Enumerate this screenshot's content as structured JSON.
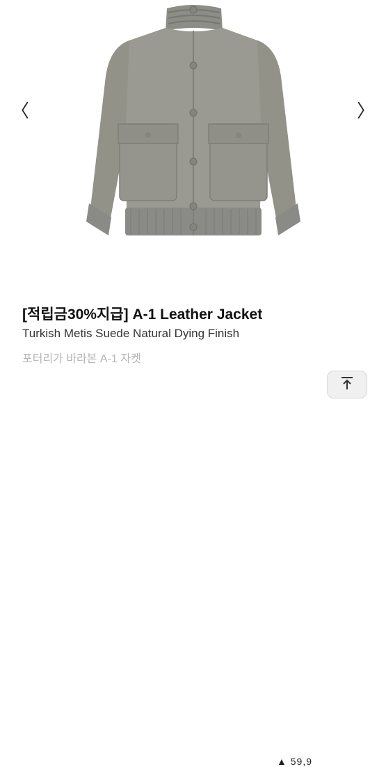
{
  "carousel": {
    "prev_icon": "chevron-left-icon",
    "next_icon": "chevron-right-icon",
    "prev_glyph": "〈",
    "next_glyph": "〉"
  },
  "product": {
    "title": "[적립금30%지급] A-1 Leather Jacket",
    "subtitle": "Turkish Metis Suede Natural Dying Finish",
    "brand_line": "포터리가 바라본 A-1 자켓",
    "price_fragment": "▲ 59,9"
  },
  "colors": {
    "jacket": "#9a9a93",
    "jacket_shadow": "#7f7f78",
    "rib": "#8a8a86",
    "title_text": "#111111",
    "muted_text": "#b5b5b5"
  },
  "scroll_top": {
    "icon": "arrow-up-to-top-icon"
  }
}
